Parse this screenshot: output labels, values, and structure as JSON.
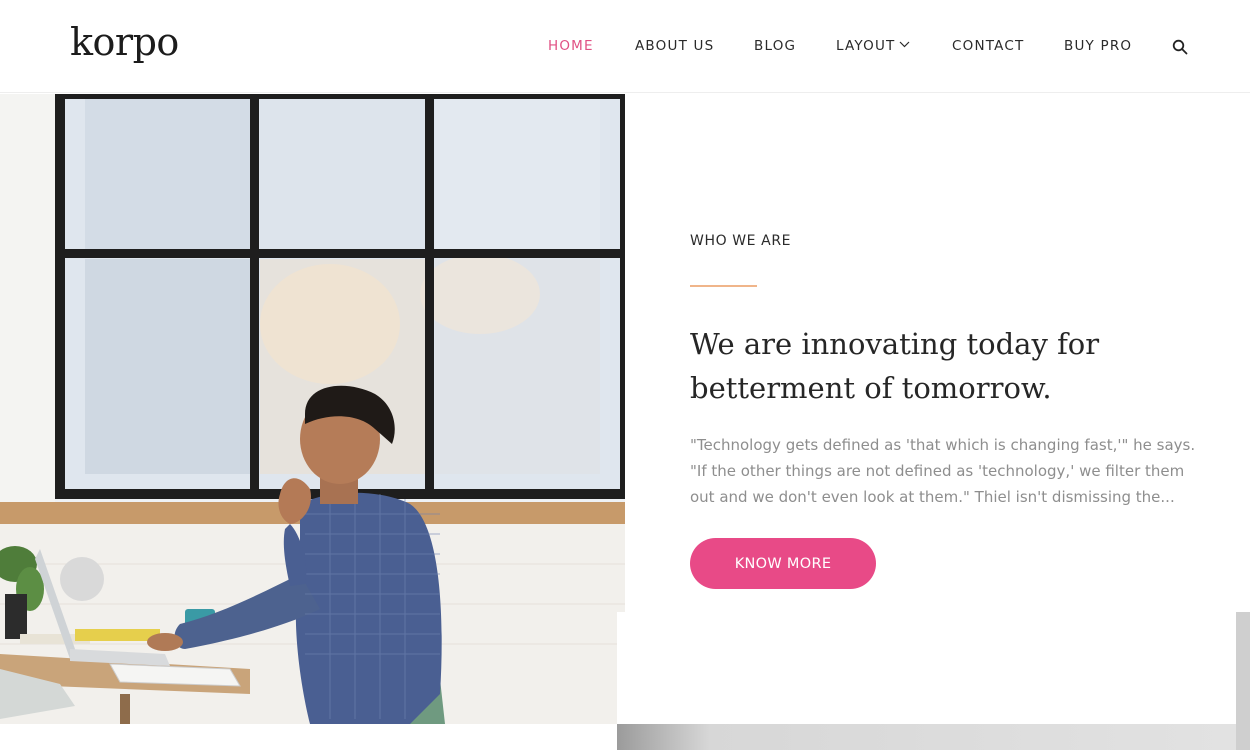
{
  "header": {
    "logo": "korpo",
    "nav": [
      {
        "label": "HOME",
        "active": true
      },
      {
        "label": "ABOUT US",
        "active": false
      },
      {
        "label": "BLOG",
        "active": false
      },
      {
        "label": "LAYOUT",
        "active": false,
        "has_dropdown": true
      },
      {
        "label": "CONTACT",
        "active": false
      },
      {
        "label": "BUY PRO",
        "active": false
      }
    ],
    "search_icon": "search-icon"
  },
  "hero": {
    "eyebrow": "WHO WE ARE",
    "headline_line1": "We are innovating today for",
    "headline_line2": "betterment of tomorrow.",
    "body_line1": "\"Technology gets defined as 'that which is changing fast,'\" he says.",
    "body_line2": "\"If the other things are not defined as 'technology,' we filter them",
    "body_line3": "out and we don't even look at them.\" Thiel isn't dismissing the...",
    "cta_label": "KNOW MORE"
  },
  "colors": {
    "accent": "#e84a87",
    "nav_active": "#e05184",
    "divider": "#f0b58a",
    "body_text": "#8e8e8e"
  }
}
